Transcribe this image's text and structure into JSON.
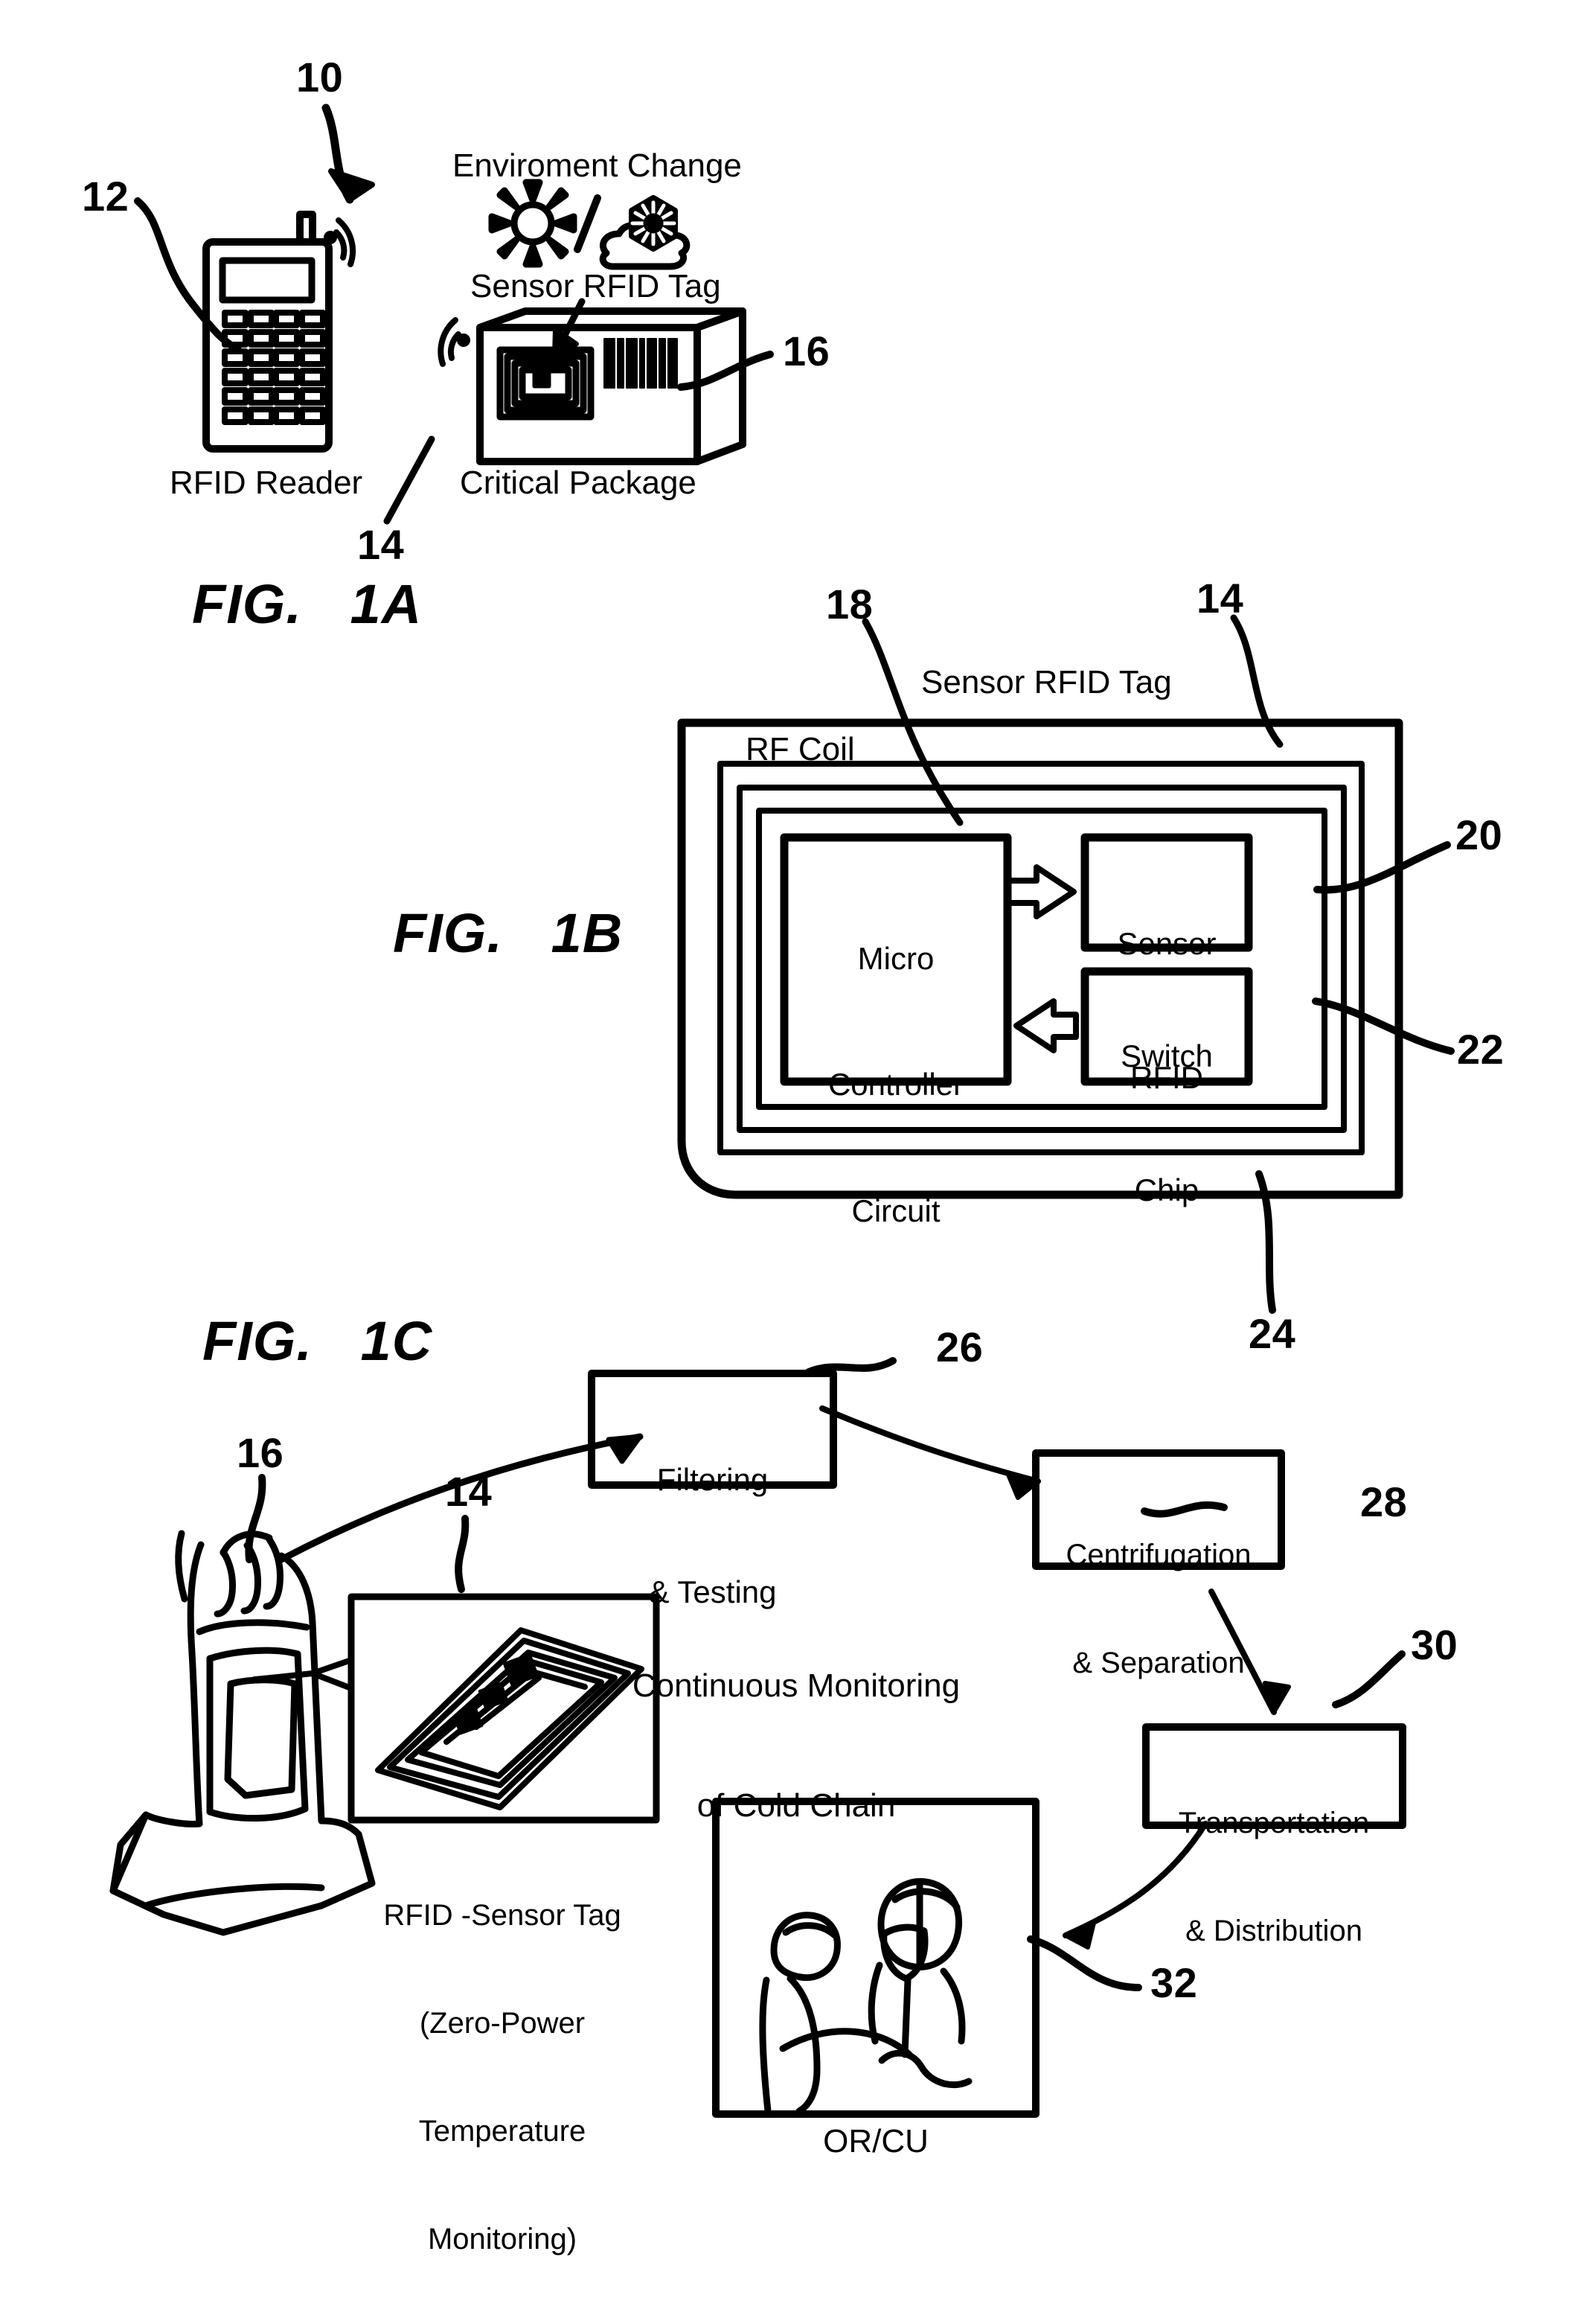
{
  "document": {
    "type": "patent-figure-sheet",
    "figures": [
      "FIG. 1A",
      "FIG. 1B",
      "FIG. 1C"
    ]
  },
  "fig1a": {
    "caption": "FIG.   1A",
    "ref_10": "10",
    "ref_12": "12",
    "ref_14": "14",
    "ref_16": "16",
    "environment_change": "Enviroment Change",
    "sensor_rfid_tag": "Sensor RFID Tag",
    "rfid_reader": "RFID Reader",
    "critical_package": "Critical Package",
    "icons": {
      "sun": "sun-icon",
      "slash": "/",
      "snow_cloud": "snow-cloud-icon",
      "rf_waves_reader": "rf-waves-icon",
      "rf_waves_package": "rf-waves-icon",
      "barcode": "barcode-icon"
    }
  },
  "fig1b": {
    "caption": "FIG.   1B",
    "ref_14": "14",
    "ref_18": "18",
    "ref_20": "20",
    "ref_22": "22",
    "ref_24": "24",
    "title": "Sensor RFID Tag",
    "rf_coil": "RF Coil",
    "micro_controller": "Micro\nController\nCircuit",
    "micro_controller_lines": [
      "Micro",
      "Controller",
      "Circuit"
    ],
    "sensor_switch": "Sensor\nSwitch",
    "sensor_switch_lines": [
      "Sensor",
      "Switch"
    ],
    "rfid_chip": "RFID\nChip",
    "rfid_chip_lines": [
      "RFID",
      "Chip"
    ],
    "arrow_switch_to_mcu": "left-arrow-icon",
    "arrow_mcu_to_chip": "right-arrow-icon"
  },
  "fig1c": {
    "caption": "FIG.   1C",
    "ref_14": "14",
    "ref_16": "16",
    "ref_26": "26",
    "ref_28": "28",
    "ref_30": "30",
    "ref_32": "32",
    "monitoring_note_lines": [
      "Continuous Monitoring",
      "of Cold Chain"
    ],
    "tag_caption_lines": [
      "RFID -Sensor Tag",
      "(Zero-Power",
      "Temperature",
      "Monitoring)"
    ],
    "orcu_label": "OR/CU",
    "steps": [
      {
        "id": "26",
        "lines": [
          "Filtering",
          "& Testing"
        ]
      },
      {
        "id": "28",
        "lines": [
          "Centrifugation",
          "& Separation"
        ]
      },
      {
        "id": "30",
        "lines": [
          "Transportation",
          "& Distribution"
        ]
      }
    ]
  },
  "colors": {
    "ink": "#000000",
    "paper": "#ffffff"
  }
}
